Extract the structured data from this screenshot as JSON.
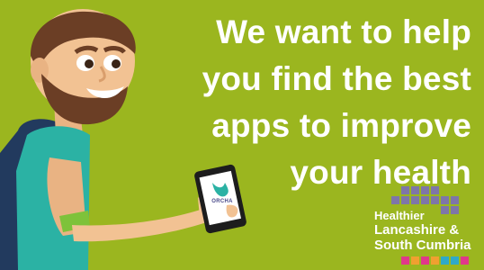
{
  "headline": {
    "line1": "We want to help",
    "line2": "you find the best",
    "line3": "apps to improve",
    "line4": "your health"
  },
  "phone": {
    "app_name": "ORCHA"
  },
  "logo": {
    "line1": "Healthier",
    "line2": "Lancashire &",
    "line3": "South Cumbria"
  },
  "colors": {
    "background": "#9bb61f",
    "headline_text": "#ffffff",
    "shirt": "#2bb2a4",
    "skin": "#f2c293",
    "beard": "#6b3e25"
  }
}
